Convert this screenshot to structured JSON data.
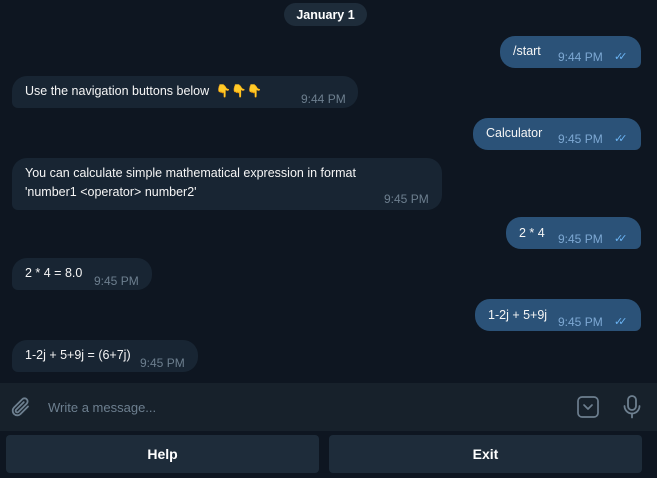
{
  "chat": {
    "date_label": "January 1",
    "messages": [
      {
        "direction": "out",
        "text": "/start",
        "time": "9:44 PM"
      },
      {
        "direction": "in",
        "text": "Use the navigation buttons below",
        "emoji": "👇👇👇",
        "time": "9:44 PM"
      },
      {
        "direction": "out",
        "text": "Calculator",
        "time": "9:45 PM"
      },
      {
        "direction": "in",
        "text_line1": "You can calculate simple mathematical expression in format",
        "text_line2": "'number1 <operator> number2'",
        "time": "9:45 PM"
      },
      {
        "direction": "out",
        "text": "2 * 4",
        "time": "9:45 PM"
      },
      {
        "direction": "in",
        "text": "2 * 4 = 8.0",
        "time": "9:45 PM"
      },
      {
        "direction": "out",
        "text": "1-2j + 5+9j",
        "time": "9:45 PM"
      },
      {
        "direction": "in",
        "text": "1-2j + 5+9j = (6+7j)",
        "time": "9:45 PM"
      }
    ],
    "read_ticks": "✓✓"
  },
  "composer": {
    "placeholder": "Write a message...",
    "value": ""
  },
  "keyboard": {
    "buttons": [
      "Help",
      "Exit"
    ]
  },
  "colors": {
    "background": "#0e1621",
    "incoming_bubble": "#182533",
    "outgoing_bubble": "#2b5278",
    "ticks": "#6ab3f3",
    "composer_bg": "#17212b",
    "button_bg": "#1e2c3a"
  },
  "icons": {
    "attach": "paperclip-icon",
    "keyboard": "bot-keyboard-icon",
    "mic": "microphone-icon"
  }
}
